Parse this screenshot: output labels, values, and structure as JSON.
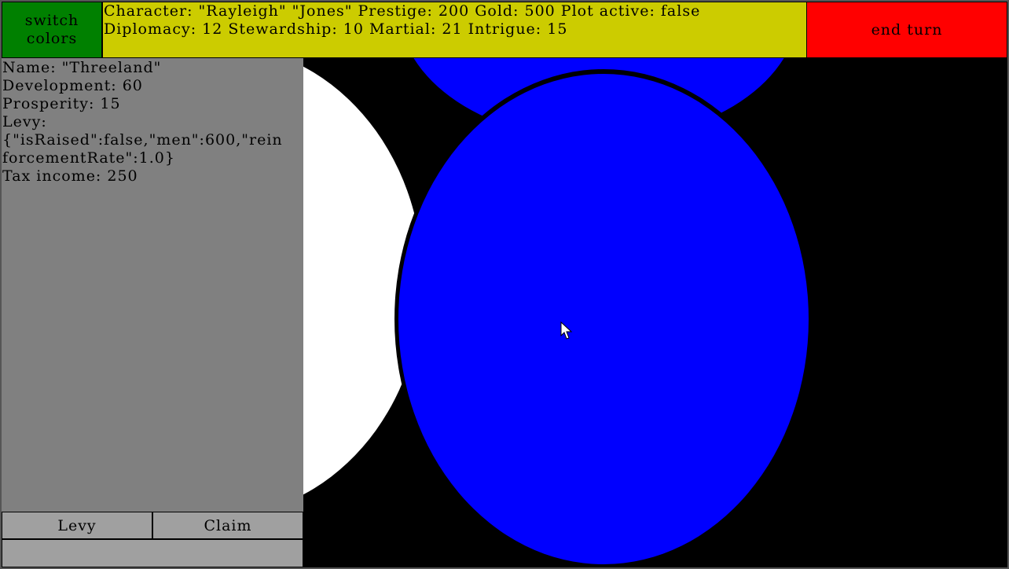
{
  "colors": {
    "switch_button": "#008000",
    "status_bar": "#cccc00",
    "end_turn": "#ff0000",
    "side_panel": "#808080",
    "map_background": "#000000",
    "province_white": "#ffffff",
    "province_blue": "#0000ff"
  },
  "toolbar": {
    "switch_line1": "switch",
    "switch_line2": "colors",
    "end_turn": "end turn"
  },
  "character": {
    "line1": "Character: \"Rayleigh\" \"Jones\" Prestige: 200 Gold: 500 Plot active: false",
    "line2": "Diplomacy: 12 Stewardship: 10 Martial: 21 Intrigue: 15"
  },
  "province": {
    "name": "Name: \"Threeland\"",
    "development": "Development: 60",
    "prosperity": "Prosperity: 15",
    "levy_label": "Levy:",
    "levy_json_1": "{\"isRaised\":false,\"men\":600,\"rein",
    "levy_json_2": "forcementRate\":1.0}",
    "tax": "Tax income: 250"
  },
  "actions": {
    "levy": "Levy",
    "claim": "Claim"
  },
  "map": {
    "provinces": [
      "white-province",
      "blue-province",
      "blue-province-north"
    ],
    "cursor_icon": "arrow-cursor-icon"
  }
}
